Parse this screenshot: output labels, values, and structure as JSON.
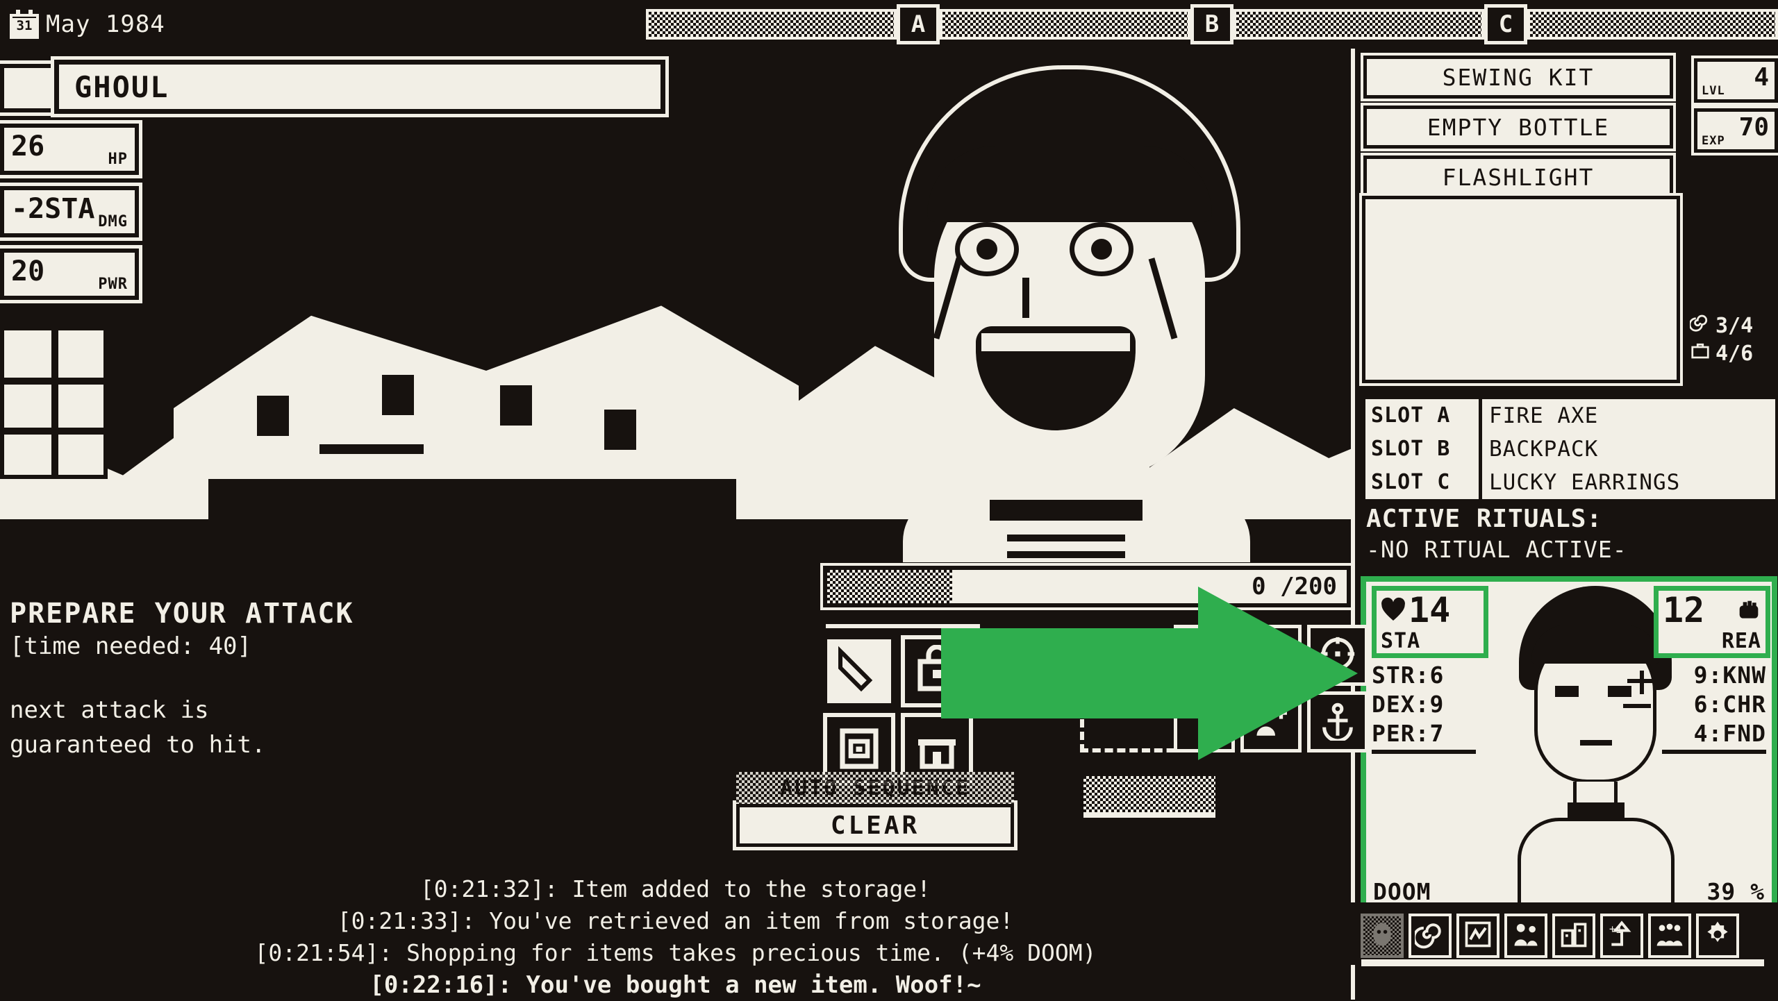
{
  "topbar": {
    "calendar_day": "31",
    "date": "May 1984",
    "slots": [
      "A",
      "B",
      "C"
    ]
  },
  "enemy": {
    "name": "GHOUL",
    "stats": [
      {
        "value": "26",
        "label": "HP"
      },
      {
        "value": "-2STA",
        "label": "DMG"
      },
      {
        "value": "20",
        "label": "PWR"
      }
    ]
  },
  "combat": {
    "headline": "PREPARE YOUR ATTACK",
    "time_needed": "[time needed: 40]",
    "body_line1": "next attack is",
    "body_line2": "guaranteed to hit."
  },
  "progress": {
    "value_text": "0 /200",
    "value": 0,
    "max": 200
  },
  "actions": {
    "grid": [
      {
        "name": "blade-action",
        "icon": "knife-icon"
      },
      {
        "name": "bag-action",
        "icon": "bag-icon"
      },
      {
        "name": "defend-action",
        "icon": "shield-icon"
      },
      {
        "name": "shop-action",
        "icon": "building-icon"
      }
    ]
  },
  "item_grid": [
    {
      "name": "item-slot-1",
      "icon": "hand-icon"
    },
    {
      "name": "item-slot-2",
      "icon": "feather-icon"
    },
    {
      "name": "item-slot-3",
      "icon": "compass-icon"
    },
    {
      "name": "item-slot-4",
      "icon": "empty-icon"
    },
    {
      "name": "item-slot-5",
      "icon": "person-plus-icon"
    },
    {
      "name": "item-slot-6",
      "icon": "anchor-icon"
    }
  ],
  "auto_clear": {
    "auto_label": "AUTO SEQUENCE",
    "clear_label": "CLEAR"
  },
  "log": {
    "lines": [
      "[0:21:32]: Item added to the storage!",
      "[0:21:33]: You've retrieved an item from storage!",
      "[0:21:54]: Shopping for items takes precious time. (+4% DOOM)",
      "[0:22:16]: You've bought a new item. Woof!~"
    ]
  },
  "inventory": {
    "items": [
      "SEWING KIT",
      "EMPTY BOTTLE",
      "FLASHLIGHT"
    ]
  },
  "level": {
    "lvl_value": "4",
    "lvl_label": "LVL",
    "exp_value": "70",
    "exp_label": "EXP"
  },
  "resources": [
    {
      "icon": "spiral-icon",
      "value": "3/4"
    },
    {
      "icon": "briefcase-icon",
      "value": "4/6"
    }
  ],
  "equipment": {
    "slots": [
      {
        "key": "SLOT A",
        "value": "FIRE AXE"
      },
      {
        "key": "SLOT B",
        "value": "BACKPACK"
      },
      {
        "key": "SLOT C",
        "value": "LUCKY EARRINGS"
      }
    ]
  },
  "rituals": {
    "header": "ACTIVE RITUALS:",
    "value": "-NO RITUAL ACTIVE-"
  },
  "character": {
    "stamina": {
      "value": "14",
      "label": "STA",
      "icon": "heart-icon"
    },
    "ready": {
      "value": "12",
      "label": "REA",
      "icon": "fist-icon"
    },
    "left_stats": [
      {
        "label": "STR",
        "value": "6"
      },
      {
        "label": "DEX",
        "value": "9"
      },
      {
        "label": "PER",
        "value": "7"
      }
    ],
    "right_stats": [
      {
        "value": "9",
        "label": "KNW"
      },
      {
        "value": "6",
        "label": "CHR"
      },
      {
        "value": "4",
        "label": "FND"
      }
    ],
    "doom_label": "DOOM",
    "doom_value": "39 %"
  },
  "iconbar": [
    {
      "name": "mask-icon",
      "enabled": false
    },
    {
      "name": "spiral-icon",
      "enabled": true
    },
    {
      "name": "chart-icon",
      "enabled": true
    },
    {
      "name": "people-icon",
      "enabled": true
    },
    {
      "name": "city-icon",
      "enabled": true
    },
    {
      "name": "levelup-icon",
      "enabled": true
    },
    {
      "name": "crowd-icon",
      "enabled": true
    },
    {
      "name": "gear-icon",
      "enabled": true
    }
  ],
  "colors": {
    "ink": "#17120f",
    "paper": "#f2efe6",
    "accent_green": "#2FAE4E"
  }
}
